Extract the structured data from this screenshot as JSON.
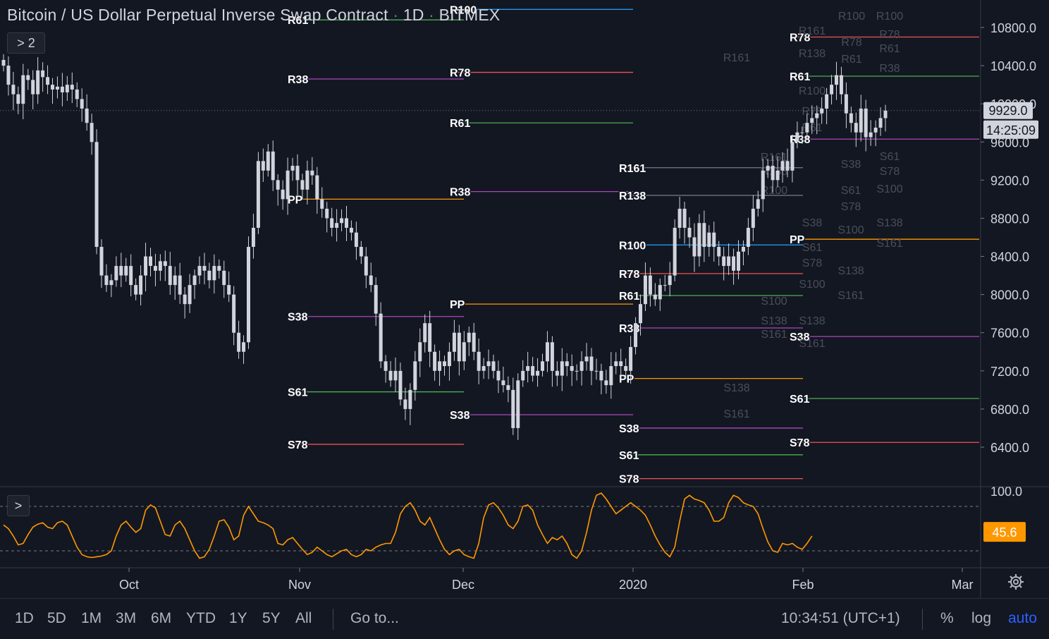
{
  "header": {
    "symbol_name": "Bitcoin / US Dollar Perpetual Inverse Swap Contract",
    "separator": "·",
    "interval": "1D",
    "exchange": "BITMEX",
    "indicators_toggle": "> 2",
    "oscillator_toggle": ">"
  },
  "bottom_bar": {
    "timeframes": [
      "1D",
      "5D",
      "1M",
      "3M",
      "6M",
      "YTD",
      "1Y",
      "5Y",
      "All"
    ],
    "goto_label": "Go to...",
    "clock": "10:34:51 (UTC+1)",
    "percent_label": "%",
    "log_label": "log",
    "auto_label": "auto"
  },
  "chart_data": [
    {
      "type": "candlestick",
      "title": "Bitcoin / US Dollar Perpetual Inverse Swap Contract · 1D · BITMEX",
      "price_ticks": [
        10800,
        10400,
        10000,
        9600,
        9200,
        8800,
        8400,
        8000,
        7600,
        7200,
        6800,
        6400
      ],
      "time_ticks": [
        "Oct",
        "Nov",
        "Dec",
        "2020",
        "Feb",
        "Mar"
      ],
      "last_price": "9929.0",
      "countdown": "14:25:09",
      "closes": [
        10400,
        10200,
        10100,
        10000,
        10300,
        10250,
        10100,
        10350,
        10280,
        10200,
        10150,
        10180,
        10120,
        10200,
        10150,
        10050,
        9950,
        9800,
        9600,
        8500,
        8200,
        8100,
        8150,
        8300,
        8200,
        8300,
        8100,
        8000,
        8200,
        8400,
        8300,
        8250,
        8350,
        8300,
        8100,
        8200,
        8000,
        7900,
        8100,
        8200,
        8300,
        8250,
        8150,
        8300,
        8250,
        8100,
        8000,
        7600,
        7400,
        7500,
        8500,
        8700,
        9400,
        9300,
        9500,
        9200,
        9100,
        9000,
        9300,
        9350,
        9200,
        9100,
        9300,
        9250,
        9000,
        8900,
        8800,
        8700,
        8750,
        8800,
        8700,
        8650,
        8500,
        8400,
        8200,
        8100,
        7800,
        7300,
        7200,
        7100,
        7200,
        6900,
        6800,
        7000,
        7300,
        7500,
        7700,
        7400,
        7200,
        7300,
        7250,
        7400,
        7600,
        7300,
        7500,
        7600,
        7400,
        7200,
        7250,
        7300,
        7200,
        7100,
        7050,
        7000,
        6600,
        7100,
        7200,
        7250,
        7150,
        7200,
        7300,
        7500,
        7200,
        7150,
        7300,
        7250,
        7200,
        7200,
        7300,
        7350,
        7200,
        7200,
        7100,
        7050,
        7250,
        7300,
        7250,
        7200,
        7450,
        7700,
        7900,
        8200,
        8000,
        7950,
        8100,
        8100,
        8200,
        8700,
        8900,
        8700,
        8600,
        8400,
        8750,
        8500,
        8650,
        8500,
        8400,
        8300,
        8400,
        8250,
        8450,
        8500,
        8700,
        8900,
        9000,
        9300,
        9350,
        9200,
        9300,
        9400,
        9300,
        9600,
        9700,
        9700,
        9800,
        9850,
        9900,
        9950,
        10100,
        10200,
        10300,
        10100,
        9900,
        9800,
        9700,
        9950,
        9650,
        9700,
        9750,
        9850,
        9929
      ],
      "pivot_levels": {
        "series_names": [
          "R161",
          "R138",
          "R100",
          "R78",
          "R61",
          "R38",
          "PP",
          "S38",
          "S61",
          "S78",
          "S100",
          "S138",
          "S161"
        ],
        "colors": {
          "R100": "#2196f3",
          "R78": "#ef5350",
          "R61": "#4caf50",
          "R38": "#ab47bc",
          "PP": "#ff9800",
          "S38": "#ab47bc",
          "S61": "#4caf50",
          "S78": "#ef5350"
        }
      }
    },
    {
      "type": "line",
      "name": "oscillator",
      "ylim": [
        0,
        100
      ],
      "upper_band": 80,
      "lower_band": 20,
      "tick_label": "100.0",
      "last_value": "45.6",
      "color": "#ff9800",
      "values": [
        55,
        50,
        40,
        28,
        30,
        42,
        52,
        56,
        58,
        52,
        50,
        58,
        60,
        55,
        40,
        25,
        15,
        12,
        11,
        12,
        13,
        15,
        20,
        40,
        55,
        60,
        52,
        45,
        50,
        75,
        82,
        78,
        60,
        42,
        40,
        55,
        60,
        50,
        35,
        20,
        10,
        12,
        22,
        40,
        60,
        62,
        52,
        35,
        40,
        68,
        80,
        70,
        60,
        58,
        55,
        50,
        30,
        28,
        35,
        38,
        30,
        22,
        15,
        18,
        25,
        20,
        15,
        12,
        16,
        20,
        22,
        15,
        12,
        15,
        22,
        20,
        25,
        28,
        30,
        30,
        45,
        70,
        80,
        85,
        75,
        60,
        55,
        65,
        50,
        35,
        22,
        15,
        20,
        22,
        15,
        12,
        10,
        30,
        65,
        82,
        85,
        78,
        68,
        55,
        50,
        60,
        80,
        82,
        75,
        55,
        42,
        30,
        38,
        35,
        40,
        30,
        15,
        10,
        20,
        45,
        75,
        95,
        98,
        90,
        80,
        70,
        75,
        80,
        85,
        80,
        75,
        68,
        55,
        40,
        28,
        18,
        12,
        25,
        60,
        90,
        95,
        90,
        88,
        85,
        75,
        60,
        60,
        65,
        85,
        95,
        92,
        85,
        82,
        80,
        70,
        50,
        32,
        20,
        18,
        30,
        28,
        30,
        25,
        22,
        30,
        40
      ]
    }
  ]
}
